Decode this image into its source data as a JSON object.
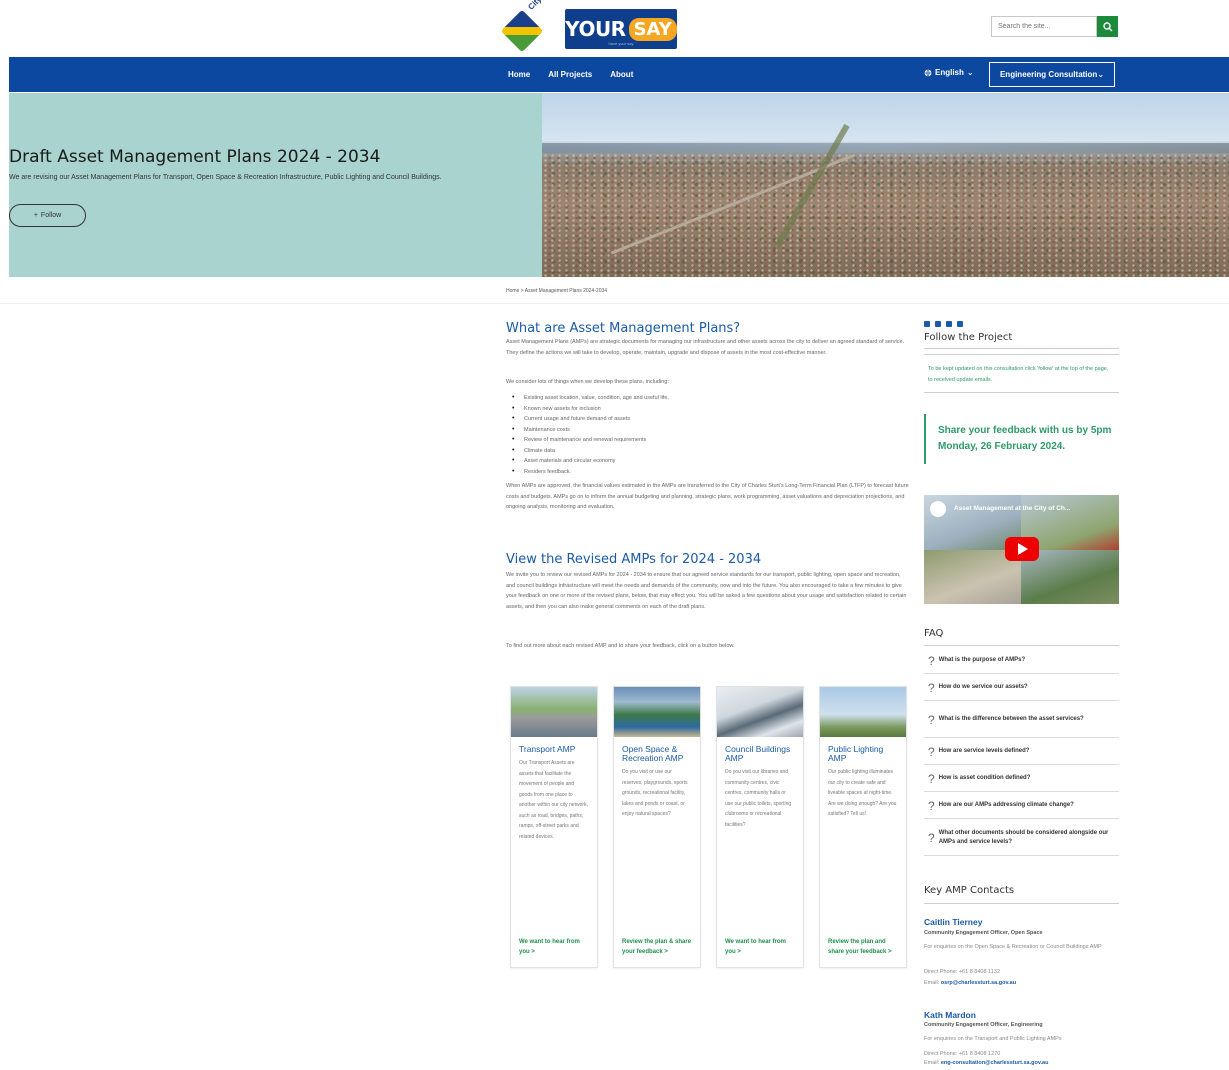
{
  "header": {
    "city_logo_text": "City of Charles Sturt",
    "yoursay_your": "YOUR",
    "yoursay_say": "SAY",
    "yoursay_tag": "have your say",
    "search_placeholder": "Search the site..."
  },
  "nav": {
    "links": [
      "Home",
      "All Projects",
      "About"
    ],
    "language": "English",
    "engineering": "Engineering Consultation"
  },
  "hero": {
    "title": "Draft Asset Management Plans 2024 - 2034",
    "subtitle": "We are revising our Asset Management Plans for Transport, Open Space & Recreation Infrastructure, Public Lighting and Council Buildings.",
    "follow": "Follow"
  },
  "breadcrumb": "Home > Asset Management Plans 2024-2034",
  "main": {
    "section1_title": "What are Asset Management Plans?",
    "section1_p1": "Asset Management Plans (AMPs) are strategic documents for managing our infrastructure and other assets across the city to deliver an agreed standard of service. They define the actions we will take to develop, operate, maintain, upgrade and dispose of assets in the most cost-effective manner.",
    "section1_p2": "We consider lots of things when we develop these plans, including:",
    "bullets": [
      "Existing asset location, value, condition, age and useful life.",
      "Known new assets for inclusion",
      "Current usage and future demand of assets",
      "Maintenance costs",
      "Review of maintenance and renewal requirements",
      "Climate data",
      "Asset materials and circular economy",
      "Residers feedback."
    ],
    "section1_p3": "When AMPs are approved, the financial values estimated in the AMPs are transferred to the City of Charles Sturt's Long-Term Financial Plan (LTFP) to forecast future costs and budgets. AMPs go on to inform the annual budgeting and planning, strategic plans, work programming, asset valuations and depreciation projections, and ongoing analysis, monitoring and evaluation.",
    "section2_title": "View the Revised AMPs for 2024 - 2034",
    "section2_p1": "We invite you to review our revised AMPs for 2024 - 2034 to ensure that our agreed service standards for our transport, public lighting, open space and recreation, and council buildings infrastructure will meet the needs and demands of the community, now and into the future. You also encouraged to take a few minutes to give your feedback on one or more of the revised plans, below, that may effect you. You will be asked a few questions about your usage and satisfaction related to certain assets, and then you can also make general comments on each of the draft plans.",
    "section2_p2": "To find out more about each revised AMP and to share your feedback, click on a button below."
  },
  "cards": [
    {
      "title": "Transport AMP",
      "text": "Our Transport Assets are assets that facilitate the movement of people and goods from one place to another within our city network, such as road, bridges, paths, ramps, off-street parks and related devices.",
      "cta": "We want to hear from you >"
    },
    {
      "title": "Open Space & Recreation AMP",
      "text": "Do you visit or use our reserves, playgrounds, sports grounds, recreational facility, lakes and ponds or coast, or enjoy natural spaces?",
      "cta": "Review the plan & share your feedback >"
    },
    {
      "title": "Council Buildings AMP",
      "text": "Do you visit our libraries and community centres, civic centres, community halls or use our public toilets, sporting clubrooms or recreational facilities?",
      "cta": "We want to hear from you >"
    },
    {
      "title": "Public Lighting AMP",
      "text": "Our public lighting illuminates our city to create safe and liveable spaces at night-time. Are we doing enough? Are you satisfied? Tell us!",
      "cta": "Review the plan and share your feedback >"
    }
  ],
  "sidebar": {
    "follow_title": "Follow the Project",
    "follow_text": "To be kept updated on this consultation click 'follow' at the top of the page, to received update emails.",
    "share_text": "Share your feedback with us by 5pm Monday, 26 February 2024.",
    "video_title": "Asset Management at the City of Ch...",
    "faq_title": "FAQ",
    "faq": [
      "What is the purpose of AMPs?",
      "How do we service our assets?",
      "What is the difference between the asset services?",
      "How are service levels defined?",
      "How is asset condition defined?",
      "How are our AMPs addressing climate change?",
      "What other documents should be considered alongside our AMPs and service levels?"
    ],
    "contacts_title": "Key AMP Contacts",
    "contacts": [
      {
        "name": "Caitlin Tierney",
        "role": "Community Engagement Officer, Open Space",
        "desc": "For enquiries on the Open Space & Recreation or Council Buildings AMP",
        "phone": "Direct Phone: +61 8 8408 1132",
        "email_label": "Email:",
        "email": "osrp@charlessturt.sa.gov.au"
      },
      {
        "name": "Kath Mardon",
        "role": "Community Engagement Officer, Engineering",
        "desc": "For enquiries on the Transport and Public Lighting AMPs",
        "phone": "Direct Phone: +61 8 8408 1270",
        "email_label": "Email:",
        "email": "eng-consultation@charlessturt.sa.gov.au"
      }
    ]
  },
  "colors": {
    "nav_blue": "#0d48a0",
    "hero_teal": "#a8d3cf",
    "link_blue": "#1a5aa8",
    "accent_green": "#2e9a6a",
    "yoursay_orange": "#f5a623"
  }
}
